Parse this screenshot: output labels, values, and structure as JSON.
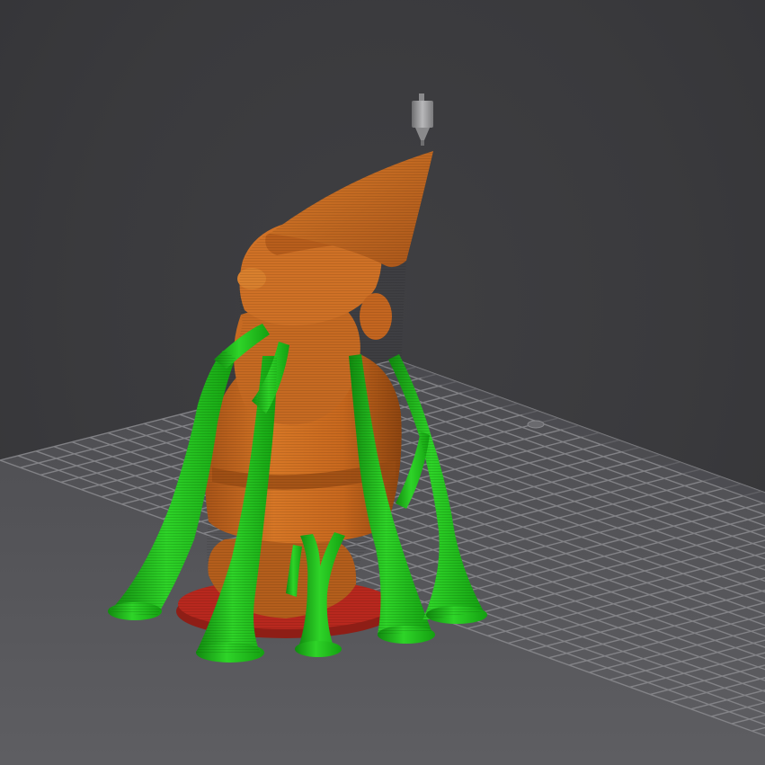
{
  "viewport": {
    "background_color": "#3a3a3d",
    "bed_color": "#58585c",
    "bed_grid_color": "#8a8a8e",
    "bed_edge_color": "#4a4a4e"
  },
  "nozzle": {
    "icon": "nozzle-icon",
    "color": "#9a9a9a"
  },
  "model": {
    "icon": "gnome-figurine",
    "body_color": "#c8681e",
    "body_highlight": "#e08a3a",
    "body_shadow": "#8e4510",
    "raft_color": "#b8281e"
  },
  "supports": {
    "icon": "tree-supports",
    "color": "#1fb81a",
    "highlight": "#3ce036",
    "shadow": "#118a0f"
  }
}
